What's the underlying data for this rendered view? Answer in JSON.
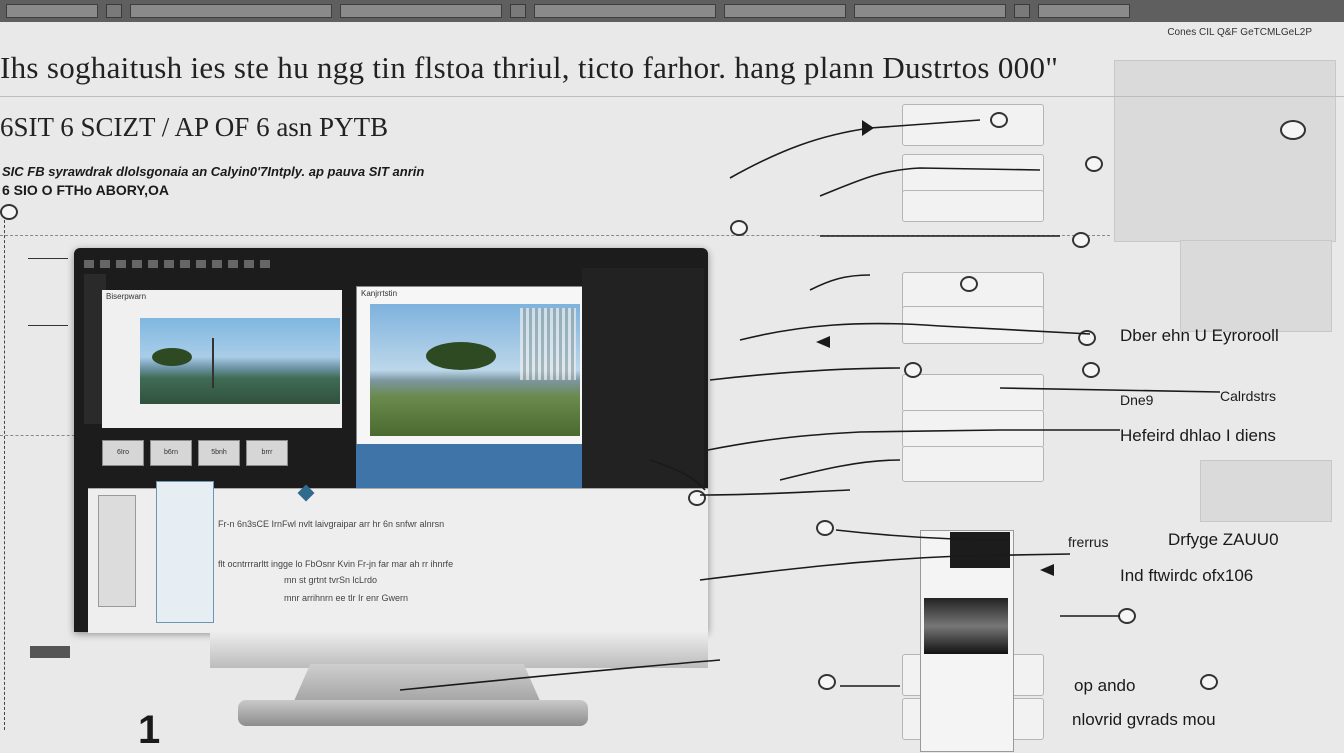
{
  "header": {
    "title": "Ihs soghaitush ies ste hu ngg tin flstoa thriul, ticto farhor. hang plann Dustrtos 000\"",
    "subtitle": "6SIT 6 SCIZT /  AP  OF 6 asn PYTB",
    "caption_line1": "SIC  FB syrawdrak dlolsgonaia an Calyin0'7Intply. ap pauva SIT  anrin",
    "caption_line2": "6 SIO  O  FTHo  ABORY,OA",
    "top_right_note": "Cones CIL Q&F GeTCMLGeL2P"
  },
  "monitor": {
    "app_header": "Biserpwarn",
    "pane2_header": "Kanjrrtstin",
    "bottom_panel_lines": [
      "Fr-n 6n3sCE IrnFwl   nvlt laivgraipar arr  hr 6n snfwr  alnrsn",
      "flt  ocntrrrarltt ingge lo  FbOsnr Kvin  Fr-jn far mar  ah rr ihnrfe",
      "mn st grtnt  tvrSn lcLrdo",
      "mnr arrihnrn ee tlr Ir enr Gwern"
    ],
    "thumb_labels": [
      "6Iro",
      "b6rn",
      "5bnh",
      "brrr"
    ]
  },
  "callouts": {
    "c1": "Dber ehn U Eyrorooll",
    "c2": "Dne9",
    "c3": "Calrdstrs",
    "c4": "Hefeird dhlao I diens",
    "c5": "frerrus",
    "c6": "Drfyge ZAUU0",
    "c7": "Ind ftwirdc ofx106",
    "c8": "op ando",
    "c9": "nlovrid gvrads mou"
  },
  "colors": {
    "background": "#e9e9e9",
    "monitor_frame": "#1c1c1c",
    "accent_blue": "#3e74a8"
  },
  "icons": [
    "cursor-arrow-icon",
    "pointer-hand-icon",
    "knob-icon"
  ]
}
